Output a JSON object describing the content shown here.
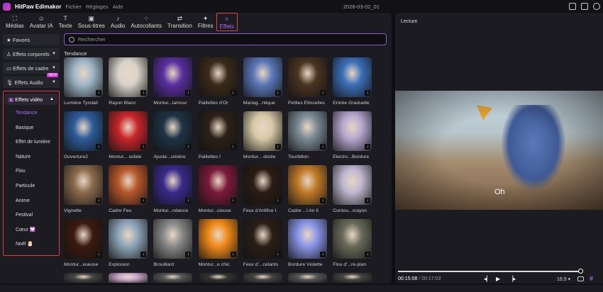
{
  "titlebar": {
    "app": "HitPaw Edimakor",
    "menus": [
      "Fichier",
      "Réglages",
      "Aide"
    ],
    "project": "2026-03-02_01"
  },
  "tabs": [
    {
      "label": "Médias",
      "icon": "media-icon",
      "glyph": "⛶"
    },
    {
      "label": "Avatar IA",
      "icon": "avatar-icon",
      "glyph": "☺"
    },
    {
      "label": "Texte",
      "icon": "text-icon",
      "glyph": "T"
    },
    {
      "label": "Sous-titres",
      "icon": "subtitles-icon",
      "glyph": "▣"
    },
    {
      "label": "Audio",
      "icon": "music-icon",
      "glyph": "♪"
    },
    {
      "label": "Autocollants",
      "icon": "stickers-icon",
      "glyph": "⁘"
    },
    {
      "label": "Transition",
      "icon": "transition-icon",
      "glyph": "⇄"
    },
    {
      "label": "Filtres",
      "icon": "filters-icon",
      "glyph": "✦"
    },
    {
      "label": "Effets",
      "icon": "effects-icon",
      "glyph": "✧",
      "active": true
    }
  ],
  "sidebar": {
    "favorites": "Favoris",
    "body": "Effets corporels",
    "frame": "Effets de cadre",
    "audio": "Effets Audio",
    "new_badge": "NEW",
    "video": "Effets vidéo",
    "subs": [
      "Tendance",
      "Basique",
      "Effet de lumière",
      "Nature",
      "Flou",
      "Particule",
      "Anime",
      "Festival",
      "Cœur 💟",
      "Noël 🎅"
    ]
  },
  "search": {
    "placeholder": "Rechercher"
  },
  "section": "Tendance",
  "effects": [
    {
      "name": "Lumière Tyndall",
      "color": "#9fb7c9"
    },
    {
      "name": "Rayon Blanc",
      "color": "#d9d4cc"
    },
    {
      "name": "Montur...lamour",
      "color": "#5a2fa0"
    },
    {
      "name": "Paillettes d'Or",
      "color": "#3a2a1a"
    },
    {
      "name": "Mariag...ntique",
      "color": "#5a78b8"
    },
    {
      "name": "Petites Étincelles",
      "color": "#4a3422"
    },
    {
      "name": "Entrée Graduelle",
      "color": "#3b6fb8"
    },
    {
      "name": "Ouverture2",
      "color": "#2d5c9a"
    },
    {
      "name": "Montur... solide",
      "color": "#c8262a"
    },
    {
      "name": "Ajuste...umière",
      "color": "#1e3346"
    },
    {
      "name": "Paillettes  I",
      "color": "#2c2118"
    },
    {
      "name": "Montur... dorée",
      "color": "#d8c9a8"
    },
    {
      "name": "Tourbillon",
      "color": "#7a8a94"
    },
    {
      "name": "Électro...Bordure",
      "color": "#b7a8d0"
    },
    {
      "name": "Vignette",
      "color": "#8b6a4c"
    },
    {
      "name": "Cadre Feu",
      "color": "#b6582a"
    },
    {
      "name": "Montur...ndance",
      "color": "#3a2a8a"
    },
    {
      "name": "Montur...cieuse",
      "color": "#7a1a3a"
    },
    {
      "name": "Feux d'Artifice  I",
      "color": "#2a1c14"
    },
    {
      "name": "Cadre ...l An II",
      "color": "#c07a28"
    },
    {
      "name": "Contou...crayon",
      "color": "#c0b8d0"
    },
    {
      "name": "Montur...xueuse",
      "color": "#3a1a10"
    },
    {
      "name": "Explosion",
      "color": "#8fa6ba"
    },
    {
      "name": "Brouillard",
      "color": "#888888"
    },
    {
      "name": "Montur...e chic",
      "color": "#f08a1a"
    },
    {
      "name": "Feux d'...celants",
      "color": "#2a1e16"
    },
    {
      "name": "Bordure Violette",
      "color": "#8a96e8"
    },
    {
      "name": "Flou d'...re-plan",
      "color": "#6a6a5a"
    },
    {
      "name": "",
      "color": "#444"
    },
    {
      "name": "",
      "color": "#c9a8c8"
    },
    {
      "name": "",
      "color": "#555"
    },
    {
      "name": "",
      "color": "#333"
    },
    {
      "name": "",
      "color": "#444"
    },
    {
      "name": "",
      "color": "#555"
    },
    {
      "name": "",
      "color": "#444"
    }
  ],
  "preview": {
    "title": "Lecture",
    "caption": "Oh",
    "current": "00:15:08",
    "total": " / 00:17:03",
    "ratio": "16:9 ▾",
    "progress": 0.96
  }
}
